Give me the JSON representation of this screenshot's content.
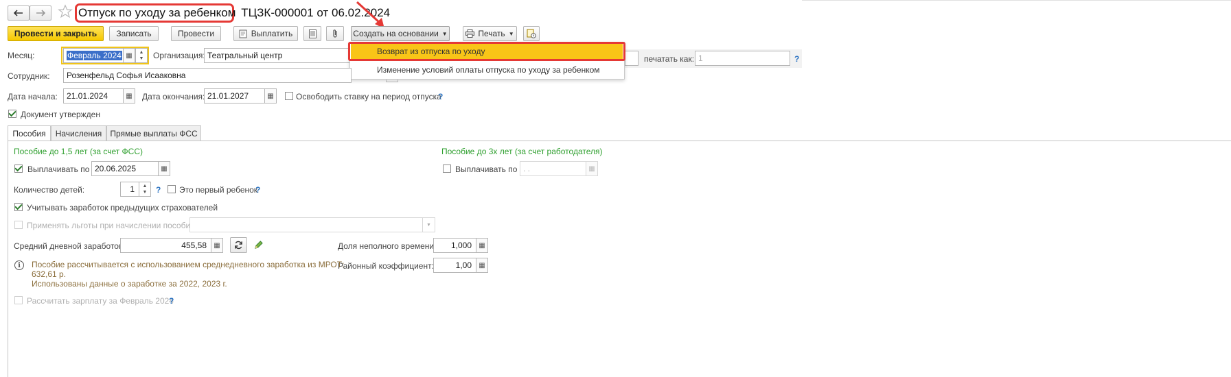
{
  "header": {
    "title_highlighted": "Отпуск по уходу за ребенком",
    "title_rest": "ТЦЗК-000001 от 06.02.2024"
  },
  "toolbar": {
    "post_close": "Провести и закрыть",
    "save": "Записать",
    "post": "Провести",
    "pay": "Выплатить",
    "create_based": "Создать на основании",
    "print": "Печать"
  },
  "dropdown": {
    "items": [
      "Возврат из отпуска по уходу",
      "Изменение условий оплаты отпуска по уходу за ребенком"
    ]
  },
  "form": {
    "month_label": "Месяц:",
    "month_value": "Февраль 2024",
    "org_label": "Организация:",
    "org_value": "Театральный центр",
    "print_as_label": "печатать как:",
    "print_as_value": "1",
    "employee_label": "Сотрудник:",
    "employee_value": "Розенфельд Софья Исааковна",
    "start_label": "Дата начала:",
    "start_value": "21.01.2024",
    "end_label": "Дата окончания:",
    "end_value": "21.01.2027",
    "release_label": "Освободить ставку на период отпуска",
    "approved_label": "Документ утвержден"
  },
  "tabs": [
    "Пособия",
    "Начисления",
    "Прямые выплаты ФСС"
  ],
  "benefits": {
    "section_left": "Пособие до 1,5 лет (за счет ФСС)",
    "section_right": "Пособие до 3х лет (за счет работодателя)",
    "pay_until_label": "Выплачивать по",
    "pay_until_value": "20.06.2025",
    "pay_until_right_label": "Выплачивать по",
    "pay_until_right_value": " .  .",
    "children_label": "Количество детей:",
    "children_value": "1",
    "first_child_label": "Это первый ребенок",
    "consider_prev_label": "Учитывать заработок предыдущих страхователей",
    "apply_benefits_label": "Применять льготы при начислении пособия",
    "avg_label": "Средний дневной заработок:",
    "avg_value": "455,58",
    "part_time_label": "Доля неполного времени:",
    "part_time_value": "1,000",
    "district_label": "Районный коэффициент:",
    "district_value": "1,00",
    "info_line1": "Пособие рассчитывается с использованием среднедневного заработка из МРОТ:",
    "info_line2": "632,61 р.",
    "info_line3": "Использованы данные о заработке за  2022,  2023 г.",
    "calc_salary_label": "Рассчитать зарплату за Февраль 2024"
  },
  "colors": {
    "highlight_red": "#e53935",
    "accent_yellow": "#f5c800",
    "section_green": "#2e9f2e",
    "help_blue": "#2d74c2",
    "info_brown": "#8a6d3b"
  }
}
